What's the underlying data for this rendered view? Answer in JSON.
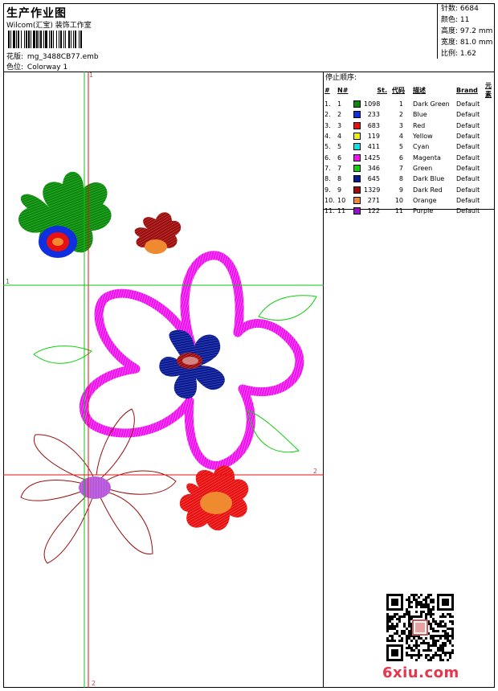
{
  "header": {
    "title": "生产作业图",
    "studio": "Wilcom(汇宝) 装饰工作室",
    "design_label": "花版:",
    "design_value": "mg_3488CB77.emb",
    "colorway_label": "色位:",
    "colorway_value": "Colorway 1"
  },
  "stats": [
    {
      "label": "针数:",
      "value": "6684"
    },
    {
      "label": "颜色:",
      "value": "11"
    },
    {
      "label": "高度:",
      "value": "97.2 mm"
    },
    {
      "label": "宽度:",
      "value": "81.0 mm"
    },
    {
      "label": "比例:",
      "value": "1.62"
    }
  ],
  "sequence": {
    "title": "停止顺序:",
    "headers": [
      "#",
      "N#",
      "St.",
      "代码",
      "描述",
      "Brand",
      "元素"
    ],
    "rows": [
      {
        "idx": "1.",
        "n": "1",
        "color": "#0a8a0a",
        "st": "1098",
        "code": "1",
        "desc": "Dark Green",
        "brand": "Default"
      },
      {
        "idx": "2.",
        "n": "2",
        "color": "#1030e0",
        "st": "233",
        "code": "2",
        "desc": "Blue",
        "brand": "Default"
      },
      {
        "idx": "3.",
        "n": "3",
        "color": "#e81010",
        "st": "683",
        "code": "3",
        "desc": "Red",
        "brand": "Default"
      },
      {
        "idx": "4.",
        "n": "4",
        "color": "#f0f010",
        "st": "119",
        "code": "4",
        "desc": "Yellow",
        "brand": "Default"
      },
      {
        "idx": "5.",
        "n": "5",
        "color": "#10e0e8",
        "st": "411",
        "code": "5",
        "desc": "Cyan",
        "brand": "Default"
      },
      {
        "idx": "6.",
        "n": "6",
        "color": "#f010f0",
        "st": "1425",
        "code": "6",
        "desc": "Magenta",
        "brand": "Default"
      },
      {
        "idx": "7.",
        "n": "7",
        "color": "#10d010",
        "st": "346",
        "code": "7",
        "desc": "Green",
        "brand": "Default"
      },
      {
        "idx": "8.",
        "n": "8",
        "color": "#0a1a90",
        "st": "645",
        "code": "8",
        "desc": "Dark Blue",
        "brand": "Default"
      },
      {
        "idx": "9.",
        "n": "9",
        "color": "#9a0e0e",
        "st": "1329",
        "code": "9",
        "desc": "Dark Red",
        "brand": "Default"
      },
      {
        "idx": "10.",
        "n": "10",
        "color": "#f08a30",
        "st": "271",
        "code": "10",
        "desc": "Orange",
        "brand": "Default"
      },
      {
        "idx": "11.",
        "n": "11",
        "color": "#9a10c8",
        "st": "122",
        "code": "11",
        "desc": "Purple",
        "brand": "Default"
      }
    ]
  },
  "guides": {
    "v1": "1",
    "v2": "2",
    "h1": "1",
    "h2": "2"
  },
  "brand_mark": {
    "text": "6xiu.com"
  }
}
